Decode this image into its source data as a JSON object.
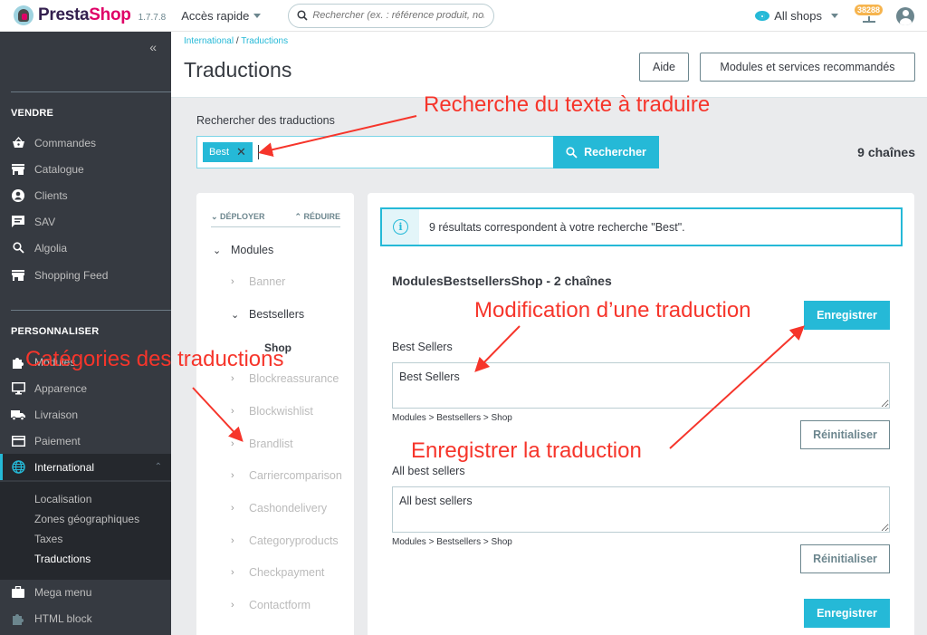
{
  "header": {
    "logo_presta": "Presta",
    "logo_shop": "Shop",
    "version": "1.7.7.8",
    "quick_access": "Accès rapide",
    "search_placeholder": "Rechercher (ex. : référence produit, nom",
    "shops_label": "All shops",
    "notifications_count": "38288"
  },
  "sidebar": {
    "collapse_icon": "«",
    "section_sell": "VENDRE",
    "sell_items": [
      {
        "label": "Commandes",
        "icon": "basket-icon"
      },
      {
        "label": "Catalogue",
        "icon": "store-icon"
      },
      {
        "label": "Clients",
        "icon": "account-circle-icon"
      },
      {
        "label": "SAV",
        "icon": "chat-icon"
      },
      {
        "label": "Algolia",
        "icon": "search-icon"
      },
      {
        "label": "Shopping Feed",
        "icon": "store-icon"
      }
    ],
    "section_customize": "PERSONNALISER",
    "customize_items": [
      {
        "label": "Modules",
        "icon": "puzzle-icon"
      },
      {
        "label": "Apparence",
        "icon": "desktop-icon"
      },
      {
        "label": "Livraison",
        "icon": "truck-icon"
      },
      {
        "label": "Paiement",
        "icon": "credit-card-icon"
      },
      {
        "label": "International",
        "icon": "globe-icon",
        "active": true
      }
    ],
    "international_sub": [
      "Localisation",
      "Zones géographiques",
      "Taxes",
      "Traductions"
    ],
    "after_items": [
      {
        "label": "Mega menu",
        "icon": "briefcase-icon"
      },
      {
        "label": "HTML block",
        "icon": "puzzle-icon"
      }
    ]
  },
  "page": {
    "breadcrumb": [
      "International",
      "Traductions"
    ],
    "title": "Traductions",
    "help_button": "Aide",
    "modules_button": "Modules et services recommandés"
  },
  "search": {
    "label": "Rechercher des traductions",
    "tag": "Best",
    "button": "Rechercher",
    "strings_count": "9 chaînes"
  },
  "tree": {
    "expand": "DÉPLOYER",
    "collapse": "RÉDUIRE",
    "root": "Modules",
    "nodes": [
      "Banner",
      "Bestsellers",
      "Blockreassurance",
      "Blockwishlist",
      "Brandlist",
      "Carriercomparison",
      "Cashondelivery",
      "Categoryproducts",
      "Checkpayment",
      "Contactform"
    ],
    "leaf": "Shop"
  },
  "results": {
    "alert": "9 résultats correspondent à votre recherche \"Best\".",
    "domain_title": "ModulesBestsellersShop - 2 chaînes",
    "save_button": "Enregistrer",
    "reset_button": "Réinitialiser",
    "strings": [
      {
        "label": "Best Sellers",
        "value": "Best Sellers",
        "path": "Modules > Bestsellers > Shop"
      },
      {
        "label": "All best sellers",
        "value": "All best sellers",
        "path": "Modules > Bestsellers > Shop"
      }
    ]
  },
  "annotations": {
    "search": "Recherche du texte à traduire",
    "categories": "Catégories des traductions",
    "modify": "Modification d’une traduction",
    "save": "Enregistrer la traduction"
  },
  "colors": {
    "primary": "#25b9d7",
    "sidebar_bg": "#363a41",
    "annotation": "#f6352b",
    "badge": "#f6b44e"
  }
}
